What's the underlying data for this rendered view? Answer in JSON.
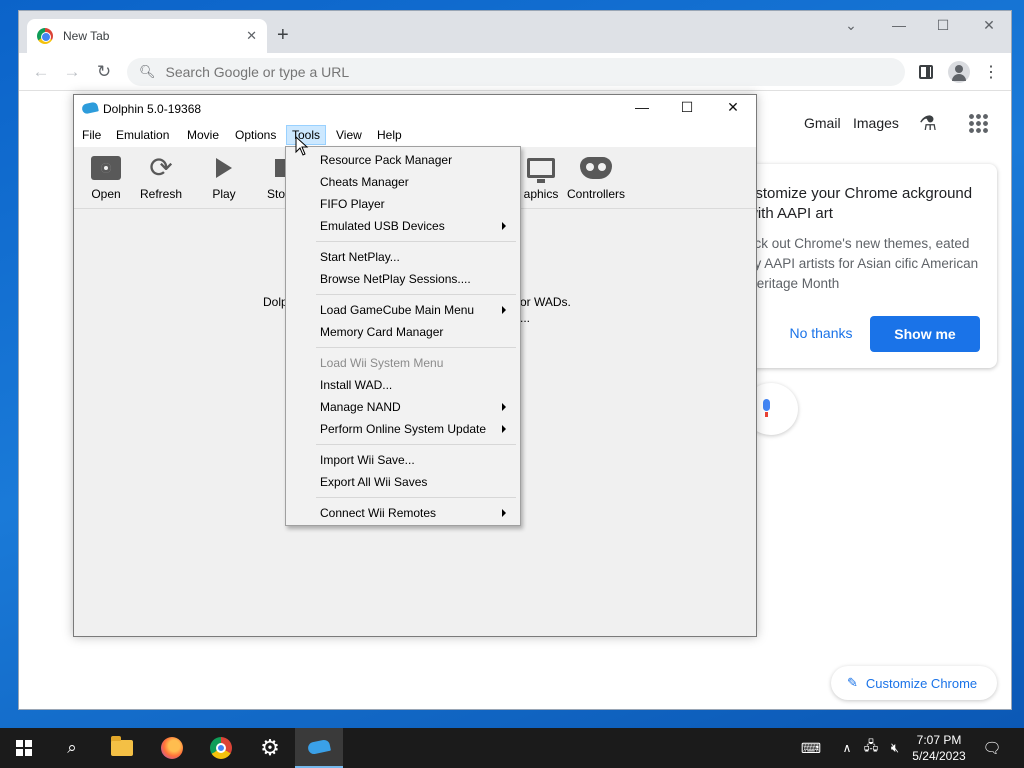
{
  "chrome": {
    "tab_title": "New Tab",
    "tab_close": "✕",
    "new_tab": "+",
    "omnibox_placeholder": "Search Google or type a URL",
    "ntp_links": [
      "Gmail",
      "Images"
    ],
    "promo": {
      "heading": "ustomize your Chrome ackground with AAPI art",
      "body": "eck out Chrome's new themes, eated by AAPI artists for Asian cific American Heritage Month",
      "no_thanks": "No thanks",
      "show_me": "Show me"
    },
    "customize_label": "Customize Chrome",
    "colors": {
      "accent": "#1a73e8",
      "tabstrip": "#dee1e6"
    }
  },
  "dolphin": {
    "title": "Dolphin 5.0-19368",
    "menu": [
      "File",
      "Emulation",
      "Movie",
      "Options",
      "Tools",
      "View",
      "Help"
    ],
    "active_menu": "Tools",
    "toolbar": [
      {
        "label": "Open",
        "icon": "open-disc-icon"
      },
      {
        "label": "Refresh",
        "icon": "refresh-icon"
      },
      {
        "label": "Play",
        "icon": "play-icon"
      },
      {
        "label": "Sto",
        "icon": "stop-icon"
      },
      {
        "label": "aphics",
        "icon": "monitor-icon"
      },
      {
        "label": "Controllers",
        "icon": "gamepad-icon"
      }
    ],
    "empty_text_line1_left": "Dolp",
    "empty_text_line1_right": "or WADs.",
    "empty_text_line2_right": "..."
  },
  "tools_menu": {
    "groups": [
      [
        {
          "label": "Resource Pack Manager",
          "submenu": false,
          "disabled": false
        },
        {
          "label": "Cheats Manager",
          "submenu": false,
          "disabled": false
        },
        {
          "label": "FIFO Player",
          "submenu": false,
          "disabled": false
        },
        {
          "label": "Emulated USB Devices",
          "submenu": true,
          "disabled": false
        }
      ],
      [
        {
          "label": "Start NetPlay...",
          "submenu": false,
          "disabled": false
        },
        {
          "label": "Browse NetPlay Sessions....",
          "submenu": false,
          "disabled": false
        }
      ],
      [
        {
          "label": "Load GameCube Main Menu",
          "submenu": true,
          "disabled": false
        },
        {
          "label": "Memory Card Manager",
          "submenu": false,
          "disabled": false
        }
      ],
      [
        {
          "label": "Load Wii System Menu",
          "submenu": false,
          "disabled": true
        },
        {
          "label": "Install WAD...",
          "submenu": false,
          "disabled": false
        },
        {
          "label": "Manage NAND",
          "submenu": true,
          "disabled": false
        },
        {
          "label": "Perform Online System Update",
          "submenu": true,
          "disabled": false
        }
      ],
      [
        {
          "label": "Import Wii Save...",
          "submenu": false,
          "disabled": false
        },
        {
          "label": "Export All Wii Saves",
          "submenu": false,
          "disabled": false
        }
      ],
      [
        {
          "label": "Connect Wii Remotes",
          "submenu": true,
          "disabled": false
        }
      ]
    ]
  },
  "taskbar": {
    "time": "7:07 PM",
    "date": "5/24/2023",
    "apps": [
      "start-icon",
      "search-icon",
      "file-explorer-icon",
      "firefox-icon",
      "chrome-icon",
      "settings-icon",
      "dolphin-icon"
    ]
  }
}
